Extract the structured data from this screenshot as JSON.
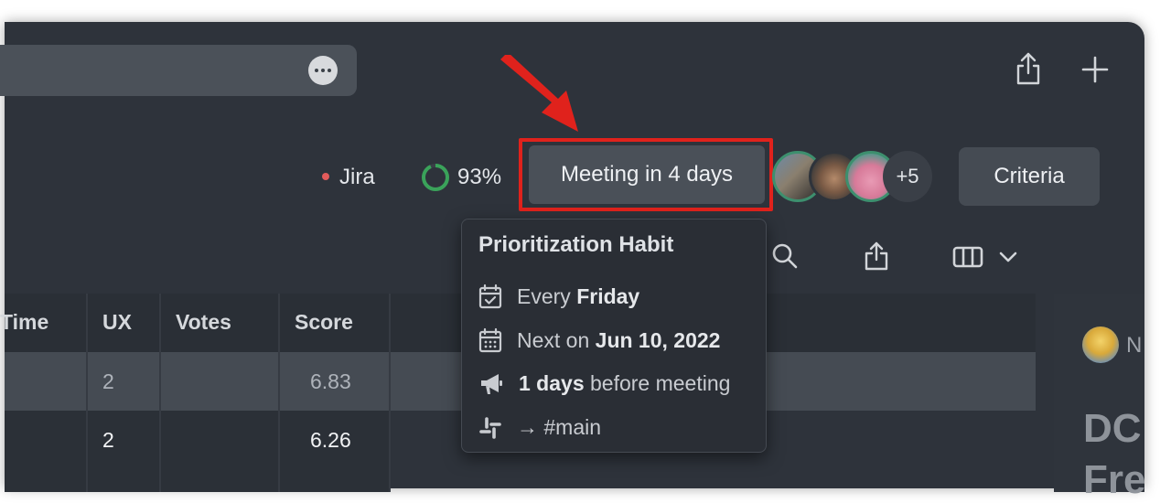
{
  "status_bar": {
    "jira_label": "Jira",
    "progress_label": "93%",
    "progress_value": 0.93,
    "meeting_label": "Meeting in 4 days",
    "more_avatars": "+5",
    "criteria_label": "Criteria"
  },
  "colors": {
    "highlight": "#e0221c",
    "arrow": "#e0221c",
    "jira_dot": "#e25b5b",
    "progress": "#3aa35a"
  },
  "table": {
    "columns": [
      "Time",
      "UX",
      "Votes",
      "Score"
    ],
    "rows": [
      {
        "ux": "2",
        "votes": "",
        "score": "6.83"
      },
      {
        "ux": "2",
        "votes": "",
        "score": "6.26"
      }
    ]
  },
  "side_panel": {
    "avatar_initial": "N",
    "heading_line1": "DC",
    "heading_line2": "Fre"
  },
  "tooltip": {
    "title": "Prioritization Habit",
    "every_prefix": "Every",
    "every_day": "Friday",
    "next_prefix": "Next on",
    "next_date": "Jun 10, 2022",
    "reminder_bold": "1 days",
    "reminder_rest": "before meeting",
    "slack_channel": "→ #main"
  },
  "icons": [
    "more-horizontal-icon",
    "share-icon",
    "plus-icon",
    "search-icon",
    "export-icon",
    "columns-icon",
    "chevron-down-icon",
    "calendar-check-icon",
    "calendar-icon",
    "megaphone-icon",
    "slack-icon",
    "progress-ring-icon"
  ]
}
